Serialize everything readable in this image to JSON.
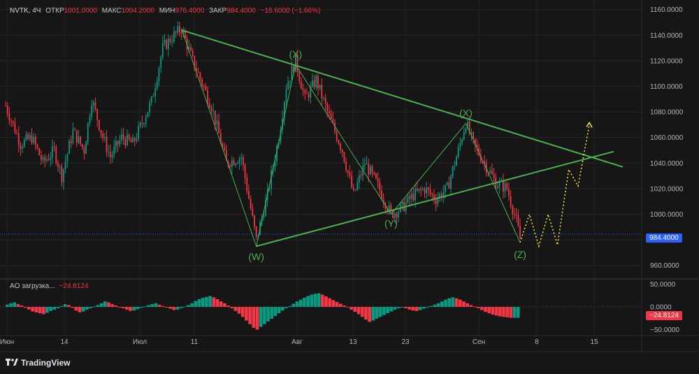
{
  "header": {
    "symbol": "NVTK, 4Ч",
    "open_label": "ОТКР",
    "open": "1001.0000",
    "high_label": "МАКС",
    "high": "1004.2000",
    "low_label": "МИН",
    "low": "976.4000",
    "close_label": "ЗАКР",
    "close": "984.4000",
    "change": "−16.6000 (−1.66%)"
  },
  "ao": {
    "label": "AO загрузка...",
    "value": "−24.8124",
    "tag": "−24.8124"
  },
  "current_price_tag": "984.4000",
  "brand": "TradingView",
  "colors": {
    "background": "#161616",
    "up": "#089981",
    "down": "#f23645",
    "trendline": "#4caf50",
    "projection": "#ffeb3b",
    "price_line": "#2962ff"
  },
  "chart_data": {
    "type": "candlestick",
    "price_axis": {
      "ylim": [
        950,
        1162
      ],
      "ticks": [
        "1160.0000",
        "1140.0000",
        "1120.0000",
        "1100.0000",
        "1080.0000",
        "1060.0000",
        "1040.0000",
        "1020.0000",
        "1000.0000",
        "980.0000",
        "960.0000"
      ]
    },
    "ao_axis": {
      "ylim": [
        -60,
        60
      ],
      "ticks": [
        "50.0000",
        "0.0000",
        "−50.0000"
      ]
    },
    "x_axis": {
      "labels": [
        "Июн",
        "14",
        "Июл",
        "11",
        "Авг",
        "13",
        "23",
        "Сен",
        "8",
        "15"
      ]
    },
    "current_price": 984.4,
    "wave_labels": [
      "(X)",
      "(W)",
      "(X)",
      "(Y)",
      "(Z)"
    ],
    "price_path": [
      [
        0,
        1085
      ],
      [
        8,
        1055
      ],
      [
        14,
        1060
      ],
      [
        20,
        1040
      ],
      [
        26,
        1050
      ],
      [
        30,
        1030
      ],
      [
        36,
        1065
      ],
      [
        42,
        1050
      ],
      [
        46,
        1090
      ],
      [
        52,
        1060
      ],
      [
        56,
        1045
      ],
      [
        62,
        1060
      ],
      [
        68,
        1055
      ],
      [
        74,
        1075
      ],
      [
        78,
        1088
      ],
      [
        84,
        1130
      ],
      [
        90,
        1140
      ],
      [
        94,
        1145
      ],
      [
        100,
        1120
      ],
      [
        110,
        1085
      ],
      [
        118,
        1040
      ],
      [
        126,
        1045
      ],
      [
        134,
        980
      ],
      [
        140,
        1015
      ],
      [
        146,
        1060
      ],
      [
        150,
        1100
      ],
      [
        155,
        1120
      ],
      [
        160,
        1090
      ],
      [
        166,
        1105
      ],
      [
        172,
        1080
      ],
      [
        180,
        1050
      ],
      [
        186,
        1015
      ],
      [
        192,
        1040
      ],
      [
        198,
        1025
      ],
      [
        206,
        1000
      ],
      [
        212,
        1005
      ],
      [
        218,
        1015
      ],
      [
        224,
        1020
      ],
      [
        230,
        1012
      ],
      [
        236,
        1020
      ],
      [
        242,
        1050
      ],
      [
        246,
        1072
      ],
      [
        250,
        1055
      ],
      [
        256,
        1040
      ],
      [
        262,
        1025
      ],
      [
        268,
        1020
      ],
      [
        273,
        995
      ],
      [
        275,
        981
      ]
    ],
    "projection_path": [
      [
        275,
        978
      ],
      [
        280,
        1000
      ],
      [
        285,
        975
      ],
      [
        290,
        1000
      ],
      [
        295,
        976
      ],
      [
        301,
        1035
      ],
      [
        306,
        1022
      ],
      [
        312,
        1070
      ]
    ],
    "wave_path": [
      [
        94,
        1145
      ],
      [
        134,
        975
      ],
      [
        155,
        1117
      ],
      [
        206,
        1000
      ],
      [
        246,
        1071
      ],
      [
        275,
        978
      ]
    ],
    "trend_lines": [
      {
        "from": [
          94,
          1144
        ],
        "to": [
          330,
          1037
        ]
      },
      {
        "from": [
          134,
          975
        ],
        "to": [
          325,
          1049
        ]
      }
    ],
    "ao_values": [
      5,
      8,
      10,
      6,
      3,
      -2,
      -6,
      -10,
      -12,
      -14,
      -16,
      -13,
      -9,
      -6,
      -3,
      2,
      6,
      4,
      -2,
      -8,
      -12,
      -10,
      -6,
      -3,
      1,
      4,
      8,
      12,
      10,
      6,
      3,
      0,
      -3,
      -6,
      -9,
      -8,
      -5,
      -2,
      1,
      4,
      6,
      8,
      5,
      2,
      -1,
      -4,
      -7,
      -6,
      -3,
      1,
      4,
      8,
      13,
      17,
      20,
      22,
      24,
      21,
      17,
      12,
      8,
      3,
      -3,
      -9,
      -15,
      -22,
      -30,
      -38,
      -46,
      -50,
      -44,
      -38,
      -32,
      -26,
      -20,
      -14,
      -8,
      -3,
      2,
      7,
      12,
      16,
      20,
      24,
      27,
      29,
      30,
      27,
      23,
      19,
      15,
      11,
      7,
      3,
      -1,
      -6,
      -11,
      -16,
      -22,
      -28,
      -33,
      -30,
      -26,
      -22,
      -18,
      -14,
      -10,
      -6,
      -3,
      -1,
      -3,
      -6,
      -8,
      -9,
      -7,
      -4,
      -1,
      2,
      5,
      8,
      12,
      16,
      19,
      21,
      19,
      16,
      12,
      8,
      4,
      1,
      -3,
      -7,
      -11,
      -14,
      -17,
      -19,
      -21,
      -22,
      -23,
      -24,
      -24,
      -24
    ]
  }
}
